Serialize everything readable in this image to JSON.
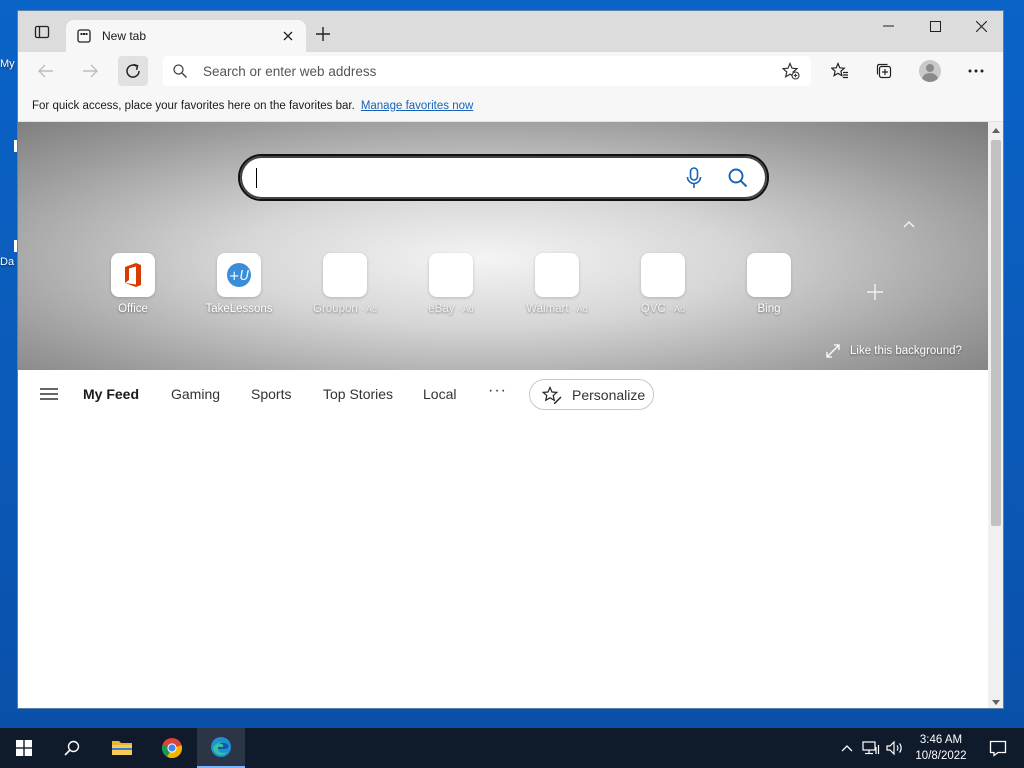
{
  "desktop": {
    "frag_top": "My",
    "frag_bottom": "Da"
  },
  "browser": {
    "tab": {
      "title": "New tab"
    },
    "address": {
      "placeholder": "Search or enter web address"
    },
    "favorites_bar": {
      "message": "For quick access, place your favorites here on the favorites bar.",
      "link": "Manage favorites now"
    }
  },
  "newtab": {
    "quick_links": [
      {
        "label": "Office",
        "ad": ""
      },
      {
        "label": "TakeLessons",
        "ad": ""
      },
      {
        "label": "Groupon",
        "ad": "· Ad"
      },
      {
        "label": "eBay",
        "ad": "· Ad"
      },
      {
        "label": "Walmart",
        "ad": "· Ad"
      },
      {
        "label": "QVC",
        "ad": "· Ad"
      },
      {
        "label": "Bing",
        "ad": ""
      }
    ],
    "like_background": "Like this background?",
    "feed_nav": {
      "items": [
        "My Feed",
        "Gaming",
        "Sports",
        "Top Stories",
        "Local"
      ],
      "more": "···",
      "personalize": "Personalize"
    }
  },
  "taskbar": {
    "time": "3:46 AM",
    "date": "10/8/2022"
  },
  "colors": {
    "accent": "#1863b8",
    "desktop": "#0a63c7",
    "taskbar": "#0f1a2a",
    "office_red": "#d83b01",
    "takelessons_blue": "#3a8ed8"
  }
}
